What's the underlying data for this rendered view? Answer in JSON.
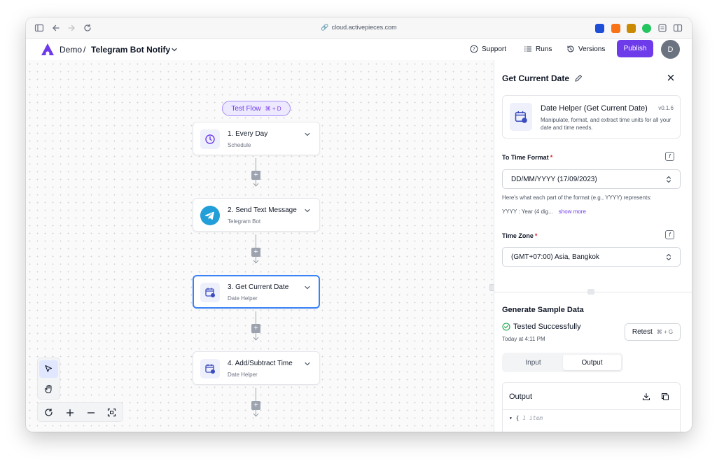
{
  "browser": {
    "url": "cloud.activepieces.com"
  },
  "header": {
    "project": "Demo",
    "separator": "/",
    "flow_name": "Telegram Bot Notify",
    "support_label": "Support",
    "runs_label": "Runs",
    "versions_label": "Versions",
    "publish_label": "Publish",
    "avatar_initial": "D",
    "accent_color": "#6e3bea"
  },
  "canvas": {
    "test_flow_label": "Test Flow",
    "test_flow_shortcut": "⌘ + D",
    "steps": [
      {
        "title": "1. Every Day",
        "subtitle": "Schedule",
        "icon": "clock-icon"
      },
      {
        "title": "2. Send Text Message",
        "subtitle": "Telegram Bot",
        "icon": "telegram-icon"
      },
      {
        "title": "3. Get Current Date",
        "subtitle": "Date Helper",
        "icon": "calendar-icon",
        "selected": true
      },
      {
        "title": "4. Add/Subtract Time",
        "subtitle": "Date Helper",
        "icon": "calendar-icon"
      }
    ],
    "plus_label": "+"
  },
  "panel": {
    "title": "Get Current Date",
    "piece": {
      "name": "Date Helper (Get Current Date)",
      "version": "v0.1.6",
      "description": "Manipulate, format, and extract time units for all your date and time needs."
    },
    "to_time_format": {
      "label": "To Time Format",
      "required_mark": "*",
      "value": "DD/MM/YYYY (17/09/2023)",
      "help": "Here's what each part of the format (e.g., YYYY) represents:",
      "help_detail": "YYYY : Year (4 dig...",
      "show_more": "show more"
    },
    "time_zone": {
      "label": "Time Zone",
      "required_mark": "*",
      "value": "(GMT+07:00) Asia, Bangkok"
    },
    "fx_label": "f",
    "sample": {
      "title": "Generate Sample Data",
      "status": "Tested Successfully",
      "time": "Today at 4:11 PM",
      "retest_label": "Retest",
      "retest_shortcut": "⌘ + G",
      "tabs": [
        "Input",
        "Output"
      ],
      "active_tab": "Output",
      "output_title": "Output",
      "json_brace": "{",
      "json_comment": "1 item"
    }
  }
}
